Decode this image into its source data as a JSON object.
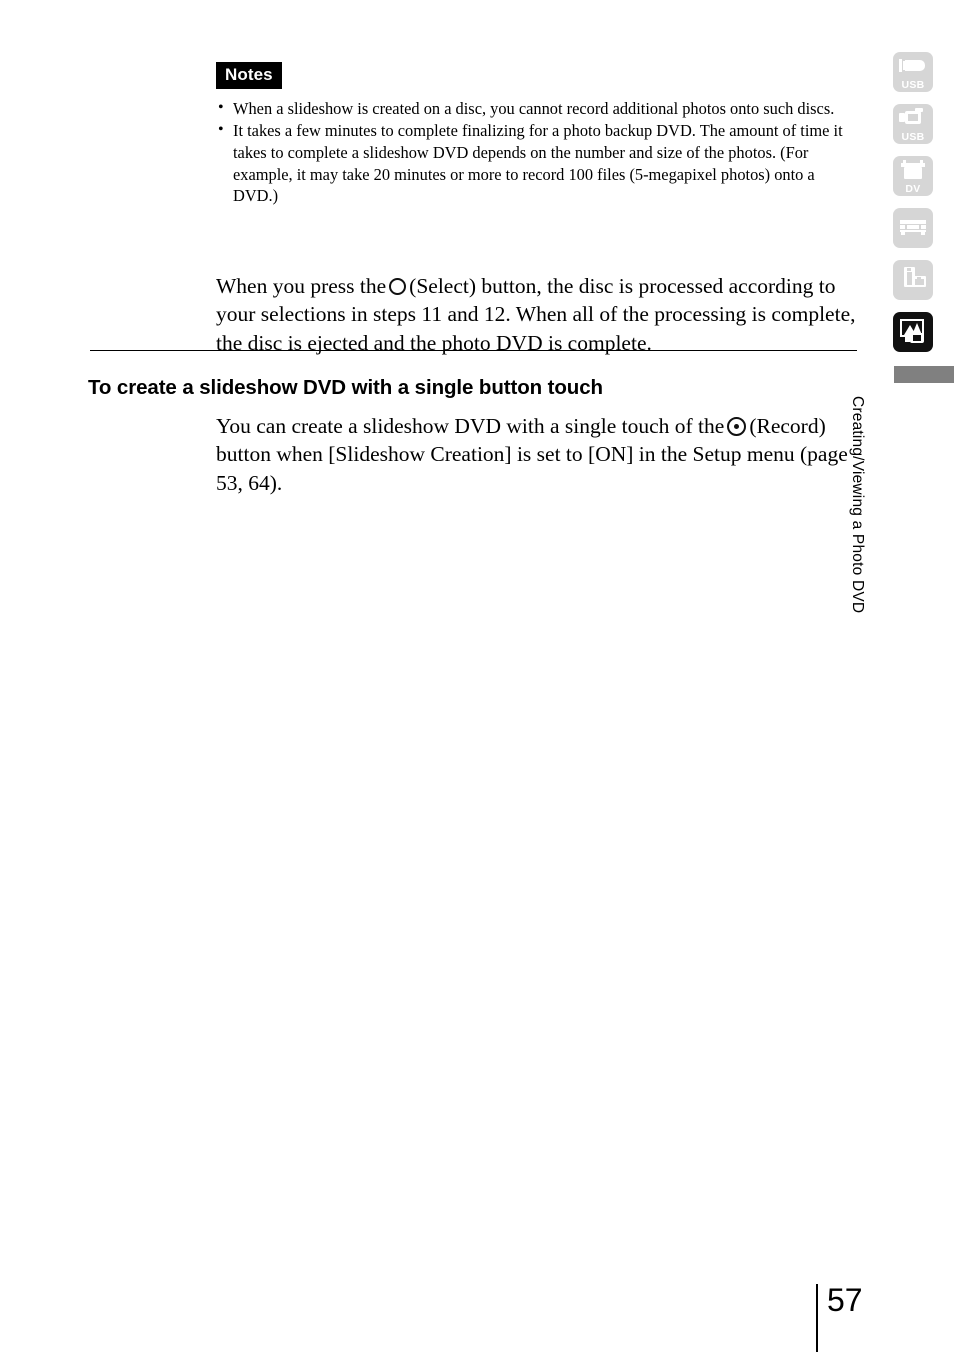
{
  "notes": {
    "badge_label": "Notes",
    "bullet_glyph": "•",
    "items": [
      "When a slideshow is created on a disc, you cannot record additional photos onto such discs.",
      "It takes a few minutes to complete finalizing for a photo backup DVD. The amount of time it takes to complete a slideshow DVD depends on the number and size of the photos. (For example, it may take 20 minutes or more to record 100 files (5-megapixel photos) onto a DVD.)"
    ]
  },
  "paragraph_select": {
    "before_icon": "When you press the",
    "icon_name": "select-button-icon",
    "after_icon": "(Select) button, the disc is processed according to your selections in steps 11 and 12. When all of the processing is complete, the disc is ejected and the photo DVD is complete."
  },
  "section": {
    "heading": "To create a slideshow DVD with a single button touch"
  },
  "paragraph_record": {
    "before_icon": "You can create a slideshow DVD with a single touch of the",
    "icon_name": "record-button-icon",
    "after_icon": "(Record) button when [Slideshow Creation] is set to [ON] in the Setup menu (page 53, 64)."
  },
  "tab_rail": {
    "items": [
      {
        "name": "usb-flash-tab",
        "label": "USB",
        "active": false
      },
      {
        "name": "usb-camcorder-tab",
        "label": "USB",
        "active": false
      },
      {
        "name": "dv-camera-tab",
        "label": "DV",
        "active": false
      },
      {
        "name": "video-deck-tab",
        "label": "",
        "active": false
      },
      {
        "name": "dubbing-tab",
        "label": "",
        "active": false
      },
      {
        "name": "photo-dvd-tab",
        "label": "",
        "active": true
      }
    ]
  },
  "running_head": {
    "text": "Creating/Viewing a Photo DVD"
  },
  "folio": {
    "page_number": "57"
  },
  "colors": {
    "ink": "#000000",
    "page": "#ffffff",
    "tab_inactive": "#d6d6d6",
    "tab_active": "#111111",
    "marker_bar": "#808080"
  }
}
